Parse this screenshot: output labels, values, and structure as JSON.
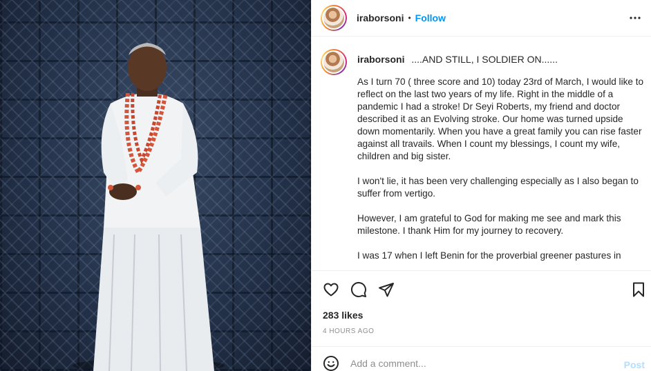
{
  "post": {
    "username": "iraborsoni",
    "separator": "•",
    "follow_label": "Follow",
    "caption_title": "....AND STILL, I SOLDIER ON......",
    "caption_paragraphs": [
      "As I turn 70 ( three score and 10) today 23rd of March, I would like to reflect on the last two years of my life. Right in the middle of a pandemic I had a stroke! Dr Seyi Roberts, my friend and doctor described it as an Evolving stroke. Our home was turned upside down momentarily. When you have a great family you can rise faster against all travails. When I count my blessings, I count my wife, children and big sister.",
      "I won't lie, it has been very challenging especially as I also began to suffer from vertigo.",
      "However, I am grateful to God for making me see and mark this milestone. I thank Him for my journey to recovery.",
      "I was 17 when I left Benin for the proverbial greener pastures in"
    ],
    "likes": "283 likes",
    "time": "4 HOURS AGO"
  },
  "comment": {
    "placeholder": "Add a comment...",
    "post_label": "Post"
  },
  "colors": {
    "accent": "#0095f6",
    "post_disabled": "#b2dffc",
    "muted": "#8e8e8e"
  },
  "icons": {
    "more": "more-options-icon",
    "like": "heart-icon",
    "comment": "comment-icon",
    "share": "share-icon",
    "save": "bookmark-icon",
    "emoji": "emoji-icon"
  }
}
